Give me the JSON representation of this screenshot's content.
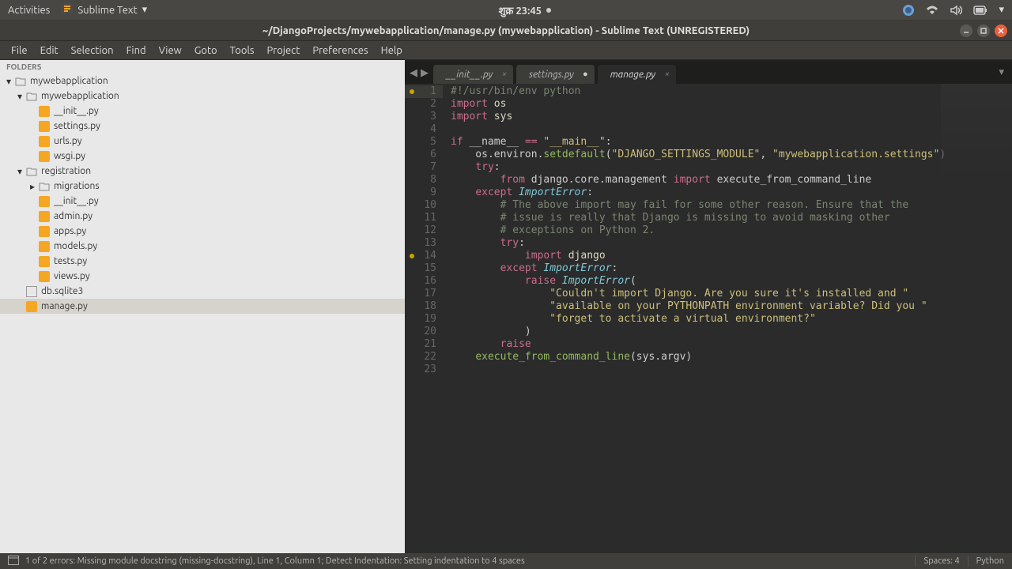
{
  "gnome": {
    "activities": "Activities",
    "app_name": "Sublime Text",
    "clock": "शुक्र 23:45"
  },
  "window": {
    "title": "~/DjangoProjects/mywebapplication/manage.py (mywebapplication) - Sublime Text (UNREGISTERED)"
  },
  "menu": [
    "File",
    "Edit",
    "Selection",
    "Find",
    "View",
    "Goto",
    "Tools",
    "Project",
    "Preferences",
    "Help"
  ],
  "sidebar": {
    "header": "FOLDERS",
    "tree": [
      {
        "type": "folder",
        "label": "mywebapplication",
        "indent": 0,
        "expanded": true
      },
      {
        "type": "folder",
        "label": "mywebapplication",
        "indent": 1,
        "expanded": true
      },
      {
        "type": "py",
        "label": "__init__.py",
        "indent": 2
      },
      {
        "type": "py",
        "label": "settings.py",
        "indent": 2
      },
      {
        "type": "py",
        "label": "urls.py",
        "indent": 2
      },
      {
        "type": "py",
        "label": "wsgi.py",
        "indent": 2
      },
      {
        "type": "folder",
        "label": "registration",
        "indent": 1,
        "expanded": true
      },
      {
        "type": "folder",
        "label": "migrations",
        "indent": 2,
        "expanded": false
      },
      {
        "type": "py",
        "label": "__init__.py",
        "indent": 2
      },
      {
        "type": "py",
        "label": "admin.py",
        "indent": 2
      },
      {
        "type": "py",
        "label": "apps.py",
        "indent": 2
      },
      {
        "type": "py",
        "label": "models.py",
        "indent": 2
      },
      {
        "type": "py",
        "label": "tests.py",
        "indent": 2
      },
      {
        "type": "py",
        "label": "views.py",
        "indent": 2
      },
      {
        "type": "db",
        "label": "db.sqlite3",
        "indent": 1
      },
      {
        "type": "py",
        "label": "manage.py",
        "indent": 1,
        "selected": true
      }
    ]
  },
  "tabs": [
    {
      "label": "__init__.py",
      "active": false,
      "dirty": false
    },
    {
      "label": "settings.py",
      "active": false,
      "dirty": true
    },
    {
      "label": "manage.py",
      "active": true,
      "dirty": false
    }
  ],
  "code": {
    "lines": [
      {
        "n": 1,
        "dot": true,
        "active": true,
        "html": "<span class='comment'>#!/usr/bin/env python</span>"
      },
      {
        "n": 2,
        "html": "<span class='kw'>import</span> <span class='var'>os</span>"
      },
      {
        "n": 3,
        "html": "<span class='kw'>import</span> <span class='var'>sys</span>"
      },
      {
        "n": 4,
        "html": ""
      },
      {
        "n": 5,
        "html": "<span class='kw'>if</span> __name__ <span class='op'>==</span> <span class='str'>\"__main__\"</span>:"
      },
      {
        "n": 6,
        "html": "    os.environ.<span class='fn'>setdefault</span>(<span class='str'>\"DJANGO_SETTINGS_MODULE\"</span>, <span class='str'>\"mywebapplication.settings\"</span>)"
      },
      {
        "n": 7,
        "html": "    <span class='kw'>try</span>:"
      },
      {
        "n": 8,
        "html": "        <span class='kw'>from</span> django.core.management <span class='kw'>import</span> execute_from_command_line"
      },
      {
        "n": 9,
        "html": "    <span class='kw'>except</span> <span class='cls'>ImportError</span>:"
      },
      {
        "n": 10,
        "html": "        <span class='comment'># The above import may fail for some other reason. Ensure that the</span>"
      },
      {
        "n": 11,
        "html": "        <span class='comment'># issue is really that Django is missing to avoid masking other</span>"
      },
      {
        "n": 12,
        "html": "        <span class='comment'># exceptions on Python 2.</span>"
      },
      {
        "n": 13,
        "html": "        <span class='kw'>try</span>:"
      },
      {
        "n": 14,
        "dot": true,
        "html": "            <span class='kw'>import</span> <span class='var'>django</span>"
      },
      {
        "n": 15,
        "html": "        <span class='kw'>except</span> <span class='cls'>ImportError</span>:"
      },
      {
        "n": 16,
        "html": "            <span class='kw'>raise</span> <span class='cls'>ImportError</span>("
      },
      {
        "n": 17,
        "html": "                <span class='str'>\"Couldn't import Django. Are you sure it's installed and \"</span>"
      },
      {
        "n": 18,
        "html": "                <span class='str'>\"available on your PYTHONPATH environment variable? Did you \"</span>"
      },
      {
        "n": 19,
        "html": "                <span class='str'>\"forget to activate a virtual environment?\"</span>"
      },
      {
        "n": 20,
        "html": "            )"
      },
      {
        "n": 21,
        "html": "        <span class='kw'>raise</span>"
      },
      {
        "n": 22,
        "html": "    <span class='fn'>execute_from_command_line</span>(sys.argv)"
      },
      {
        "n": 23,
        "html": ""
      }
    ]
  },
  "status": {
    "error": "1 of 2 errors: Missing module docstring (missing-docstring), Line 1, Column 1; Detect Indentation: Setting indentation to 4 spaces",
    "spaces": "Spaces: 4",
    "lang": "Python"
  }
}
